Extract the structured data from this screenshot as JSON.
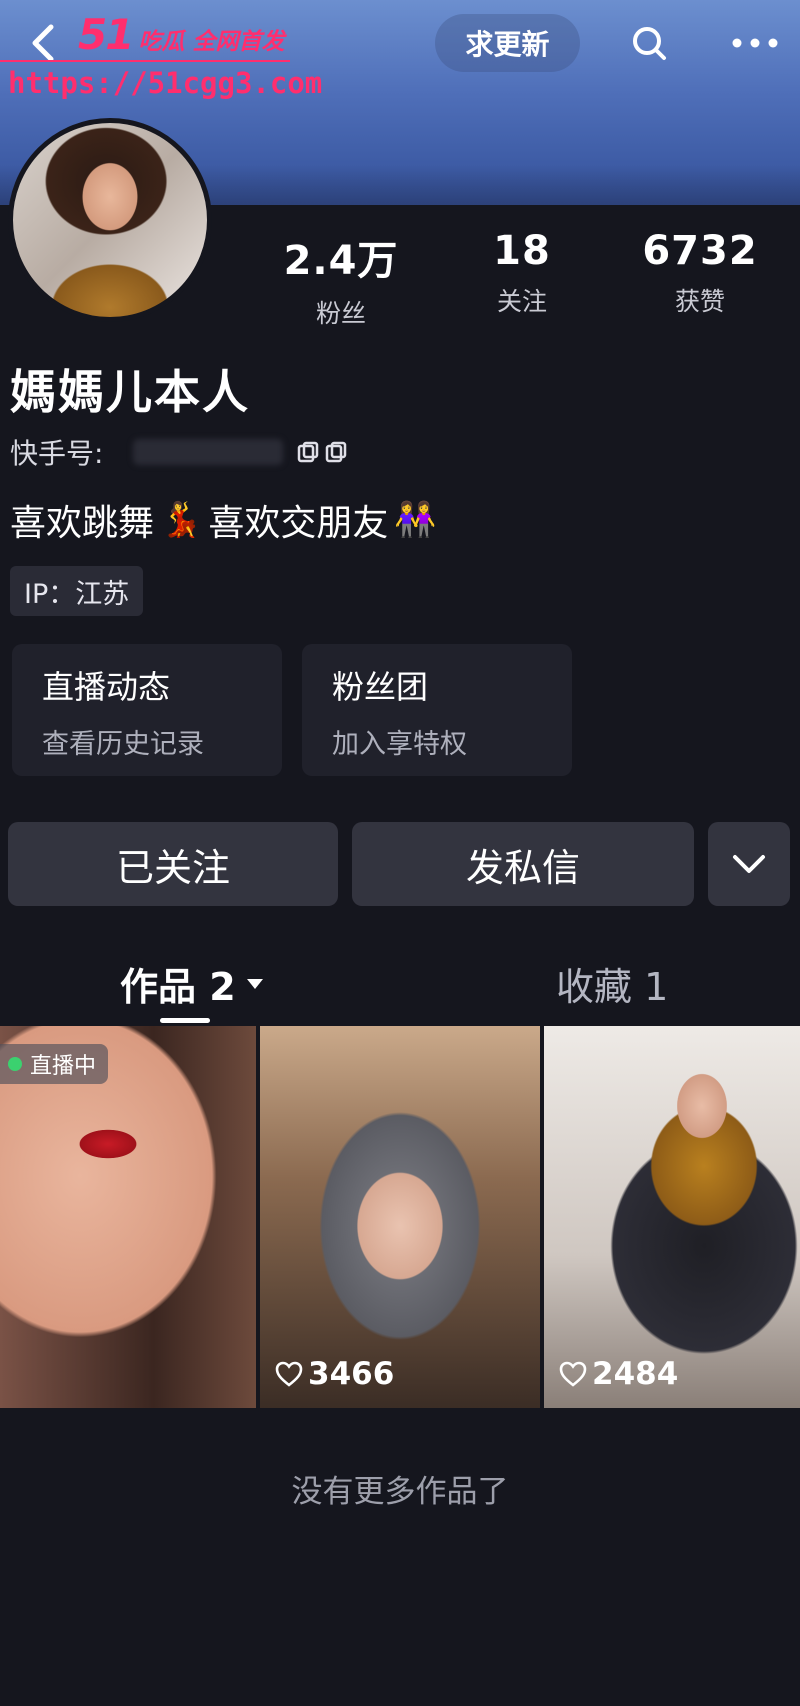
{
  "header": {
    "watermark_logo_num": "51",
    "watermark_logo_text": "吃瓜 全网首发",
    "watermark_url": "https://51cgg3.com",
    "request_update_label": "求更新"
  },
  "profile": {
    "stats": [
      {
        "value": "2.4万",
        "label": "粉丝"
      },
      {
        "value": "18",
        "label": "关注"
      },
      {
        "value": "6732",
        "label": "获赞"
      }
    ],
    "name": "媽媽儿本人",
    "kuaishou_id_label": "快手号:",
    "bio_part1": "喜欢跳舞",
    "bio_part2": "喜欢交朋友",
    "ip_label": "IP：江苏"
  },
  "cards": {
    "live": {
      "title": "直播动态",
      "subtitle": "查看历史记录"
    },
    "fans": {
      "title": "粉丝团",
      "subtitle": "加入享特权"
    }
  },
  "actions": {
    "followed_label": "已关注",
    "message_label": "发私信"
  },
  "tabs": {
    "works_label": "作品 2",
    "favorites_label": "收藏 1"
  },
  "videos": [
    {
      "badge": "直播中",
      "likes": ""
    },
    {
      "badge": "",
      "likes": "3466"
    },
    {
      "badge": "",
      "likes": "2484"
    }
  ],
  "footer": {
    "no_more_label": "没有更多作品了"
  },
  "icons": {
    "back": "chevron-left-icon",
    "search": "search-icon",
    "more": "more-dots-icon",
    "copy": "copy-icon",
    "dropdown": "chevron-down-icon",
    "heart": "heart-icon"
  },
  "colors": {
    "background": "#15161e",
    "banner": "#4f6fb9",
    "watermark": "#ff2e6e",
    "button": "#33343f",
    "live_dot": "#3bd16f"
  }
}
